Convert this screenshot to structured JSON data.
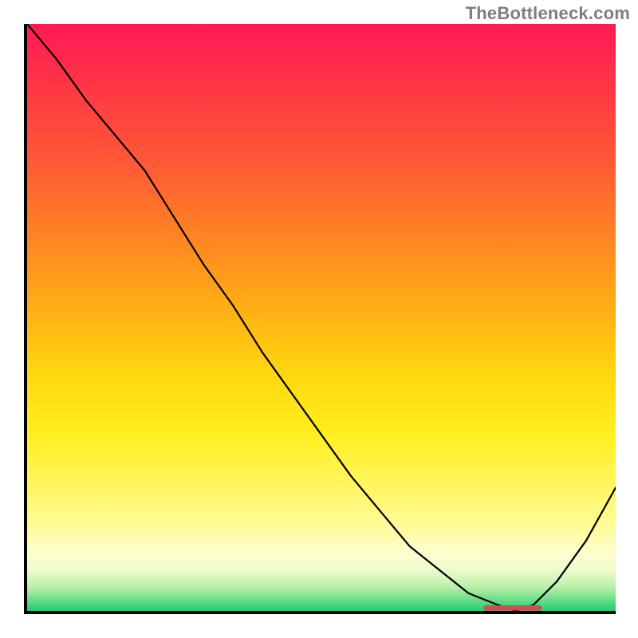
{
  "watermark": "TheBottleneck.com",
  "colors": {
    "axis": "#000000",
    "curve": "#000000",
    "marker": "#d94a52",
    "gradient_stops": [
      "#ff1a54",
      "#ff2f48",
      "#ff5a35",
      "#ff8a20",
      "#ffb414",
      "#ffd80f",
      "#ffef20",
      "#fff76a",
      "#fffb9e",
      "#feffce",
      "#eefccc",
      "#b8f0a8",
      "#46d67e",
      "#2bc96f"
    ]
  },
  "chart_data": {
    "type": "line",
    "title": "",
    "xlabel": "",
    "ylabel": "",
    "axes_note": "No numeric tick labels are visible; x and y given as fractions of plot width/height (0 at left/bottom, 1 at right/top). Values are read from the curve shape.",
    "xlim": [
      0,
      1
    ],
    "ylim": [
      0,
      1
    ],
    "series": [
      {
        "name": "bottleneck-curve",
        "x": [
          0.0,
          0.05,
          0.1,
          0.15,
          0.2,
          0.25,
          0.3,
          0.35,
          0.4,
          0.45,
          0.5,
          0.55,
          0.6,
          0.65,
          0.7,
          0.75,
          0.8,
          0.83,
          0.86,
          0.9,
          0.95,
          1.0
        ],
        "y": [
          1.0,
          0.94,
          0.87,
          0.81,
          0.75,
          0.67,
          0.59,
          0.52,
          0.44,
          0.37,
          0.3,
          0.23,
          0.17,
          0.11,
          0.07,
          0.03,
          0.01,
          0.0,
          0.01,
          0.05,
          0.12,
          0.21
        ]
      }
    ],
    "annotations": [
      {
        "name": "optimum-marker",
        "type": "segment",
        "x0": 0.78,
        "x1": 0.87,
        "y": 0.005,
        "note": "Short red horizontal marker near the curve minimum"
      }
    ]
  }
}
